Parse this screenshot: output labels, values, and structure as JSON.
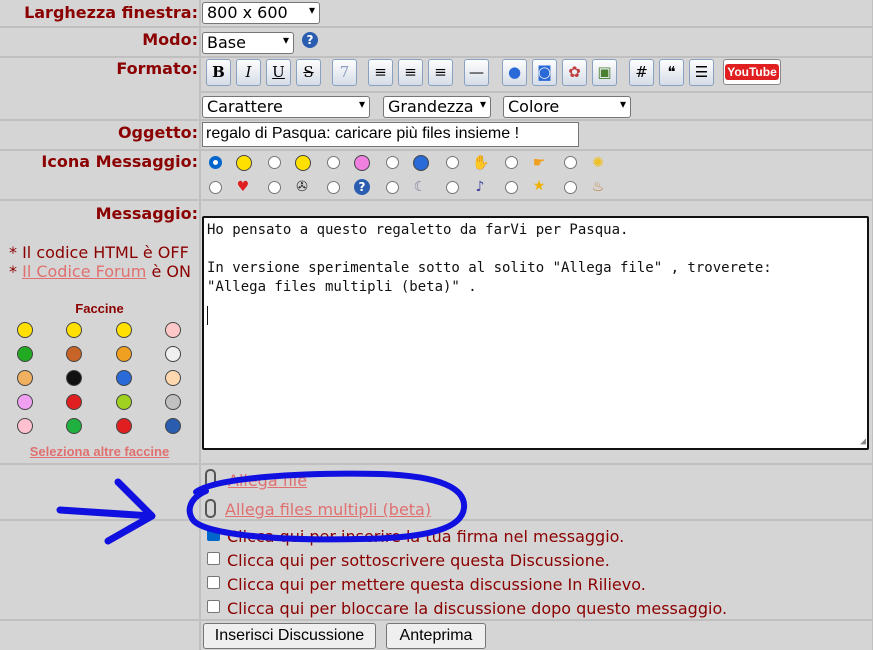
{
  "rows": {
    "window_width": {
      "label": "Larghezza finestra:",
      "value": "800 x 600"
    },
    "mode": {
      "label": "Modo:",
      "value": "Base"
    },
    "format": {
      "label": "Formato:",
      "buttons": [
        "B",
        "I",
        "U",
        "S",
        "7",
        "≡",
        "≡",
        "≡",
        "—",
        "●",
        "◙",
        "✿",
        "▣",
        "#",
        "❝",
        "☰"
      ],
      "youtube": "YouTube",
      "font_select": "Carattere",
      "size_select": "Grandezza",
      "color_select": "Colore"
    },
    "subject": {
      "label": "Oggetto:",
      "value": "regalo di Pasqua: caricare più files insieme !"
    },
    "icon": {
      "label": "Icona Messaggio:"
    },
    "message": {
      "label": "Messaggio:",
      "text_line1": "Ho pensato a questo regaletto da farVi per Pasqua.",
      "text_line2": "In versione sperimentale sotto al solito \"Allega file\" , troverete:",
      "text_line3": "\"Allega files multipli (beta)\" ."
    }
  },
  "notes": {
    "html_prefix": "* Il codice HTML è OFF",
    "forum_prefix": "* ",
    "forum_link": "Il Codice Forum",
    "forum_suffix": " è ON"
  },
  "smilies": {
    "title": "Faccine",
    "more_link": "Seleziona altre faccine",
    "colors": [
      "#ffe000",
      "#ffe000",
      "#ffe000",
      "#ffc8c8",
      "#22aa22",
      "#c86428",
      "#f0a020",
      "#f0f0f0",
      "#f0b060",
      "#111111",
      "#2a6ad8",
      "#ffd8b0",
      "#f0a0f0",
      "#e02020",
      "#a0d020",
      "#c0c0c0",
      "#ffc0d0",
      "#20b040",
      "#e02020",
      "#2a5db0"
    ]
  },
  "attachments": {
    "single": "Allega file",
    "multiple": "Allega files multipli (beta)"
  },
  "options": [
    "Clicca qui per inserire la tua firma nel messaggio.",
    "Clicca qui per sottoscrivere questa Discussione.",
    "Clicca qui per mettere questa discussione In Rilievo.",
    "Clicca qui per bloccare la discussione dopo questo messaggio."
  ],
  "buttons": {
    "submit": "Inserisci Discussione",
    "preview": "Anteprima"
  },
  "colors": {
    "label": "#8b0000",
    "link": "#e07070",
    "annotation": "#1010e0",
    "panel": "#d5d5d5"
  }
}
